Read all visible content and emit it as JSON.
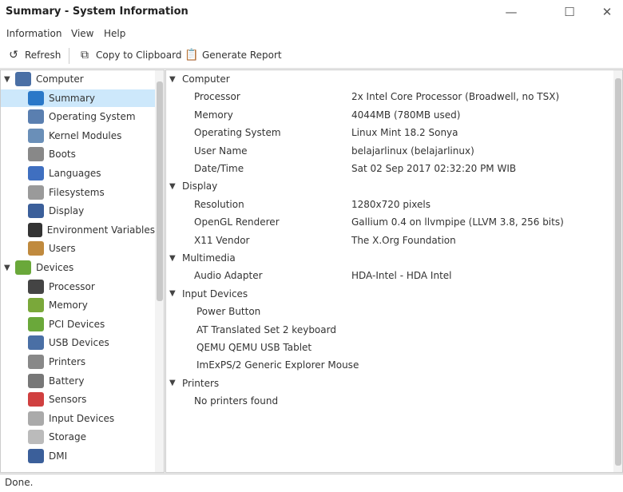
{
  "window": {
    "title": "Summary - System Information",
    "minimize": "—",
    "maximize": "☐",
    "close": "✕"
  },
  "menu": [
    "Information",
    "View",
    "Help"
  ],
  "toolbar": {
    "refresh": "Refresh",
    "copy": "Copy to Clipboard",
    "report": "Generate Report"
  },
  "tree": [
    {
      "label": "Computer",
      "group": true,
      "color": "#4a6fa5"
    },
    {
      "label": "Summary",
      "color": "#2a78c8",
      "selected": true
    },
    {
      "label": "Operating System",
      "color": "#5a7fb0"
    },
    {
      "label": "Kernel Modules",
      "color": "#6a8fb8"
    },
    {
      "label": "Boots",
      "color": "#888888"
    },
    {
      "label": "Languages",
      "color": "#3f6fc0"
    },
    {
      "label": "Filesystems",
      "color": "#9a9a9a"
    },
    {
      "label": "Display",
      "color": "#3b5f9a"
    },
    {
      "label": "Environment Variables",
      "color": "#333333"
    },
    {
      "label": "Users",
      "color": "#c08a3e"
    },
    {
      "label": "Devices",
      "group": true,
      "color": "#6aa83a"
    },
    {
      "label": "Processor",
      "color": "#444444"
    },
    {
      "label": "Memory",
      "color": "#7aa83a"
    },
    {
      "label": "PCI Devices",
      "color": "#6aa83a"
    },
    {
      "label": "USB Devices",
      "color": "#4a6fa5"
    },
    {
      "label": "Printers",
      "color": "#888888"
    },
    {
      "label": "Battery",
      "color": "#777777"
    },
    {
      "label": "Sensors",
      "color": "#d04040"
    },
    {
      "label": "Input Devices",
      "color": "#aaaaaa"
    },
    {
      "label": "Storage",
      "color": "#bbbbbb"
    },
    {
      "label": "DMI",
      "color": "#3b5f9a"
    }
  ],
  "details": [
    {
      "section": "Computer"
    },
    {
      "label": "Processor",
      "value": "2x Intel Core Processor (Broadwell, no TSX)"
    },
    {
      "label": "Memory",
      "value": "4044MB (780MB used)"
    },
    {
      "label": "Operating System",
      "value": "Linux Mint 18.2 Sonya"
    },
    {
      "label": "User Name",
      "value": "belajarlinux (belajarlinux)"
    },
    {
      "label": "Date/Time",
      "value": "Sat 02 Sep 2017 02:32:20 PM WIB"
    },
    {
      "section": "Display"
    },
    {
      "label": "Resolution",
      "value": "1280x720 pixels"
    },
    {
      "label": "OpenGL Renderer",
      "value": "Gallium 0.4 on llvmpipe (LLVM 3.8, 256 bits)"
    },
    {
      "label": "X11 Vendor",
      "value": "The X.Org Foundation"
    },
    {
      "section": "Multimedia"
    },
    {
      "label": "Audio Adapter",
      "value": "HDA-Intel - HDA Intel"
    },
    {
      "section": "Input Devices"
    },
    {
      "item": "Power Button"
    },
    {
      "item": "AT Translated Set 2 keyboard"
    },
    {
      "item": "QEMU QEMU USB Tablet"
    },
    {
      "item": "ImExPS/2 Generic Explorer Mouse"
    },
    {
      "section": "Printers"
    },
    {
      "label": "No printers found",
      "value": ""
    }
  ],
  "status": "Done."
}
